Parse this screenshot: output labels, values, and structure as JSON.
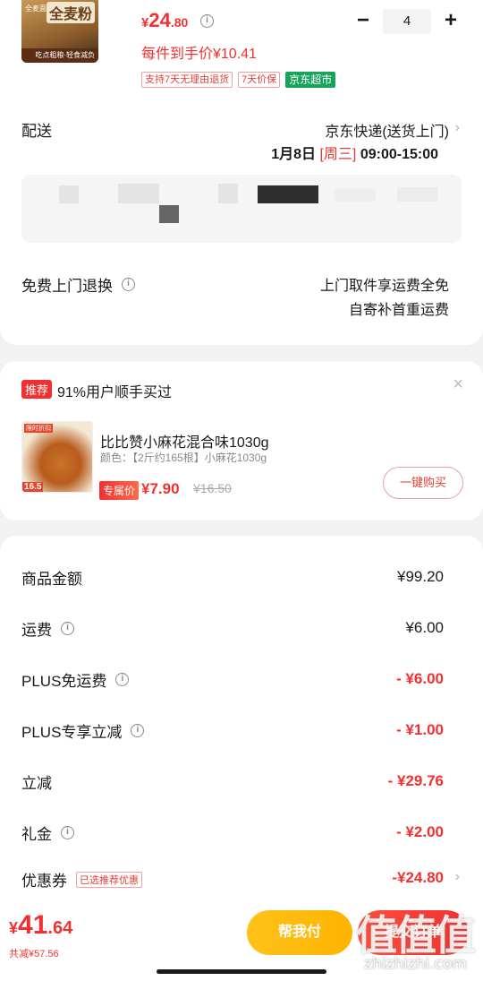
{
  "product": {
    "thumb_title": "全麦粉",
    "thumb_corner": "全麦面",
    "thumb_bottom": "吃点粗粮·轻食减负",
    "price_yen": "¥",
    "price_int": "24",
    "price_dec": ".80",
    "per_unit": "每件到手价¥10.41",
    "tags": [
      "支持7天无理由退货",
      "7天价保",
      "京东超市"
    ],
    "qty": "4",
    "minus": "−",
    "plus": "+"
  },
  "delivery": {
    "label": "配送",
    "method": "京东快递(送货上门)",
    "date": "1月8日",
    "weekday": "[周三]",
    "time": "09:00-15:00"
  },
  "return_service": {
    "label": "免费上门退换",
    "line1": "上门取件享运费全免",
    "line2": "自寄补首重运费"
  },
  "recommend": {
    "badge": "推荐",
    "title": "91%用户顺手买过",
    "close": "×",
    "img_top": "限时折扣",
    "img_bottom": "16.5",
    "name": "比比赞小麻花混合味1030g",
    "spec": "颜色：【2斤约165根】小麻花1030g",
    "exclusive": "专属价",
    "price": "¥7.90",
    "original": "¥16.50",
    "buy": "一键购买"
  },
  "summary": [
    {
      "label": "商品金额",
      "value": "¥99.20",
      "info": false,
      "red": false
    },
    {
      "label": "运费",
      "value": "¥6.00",
      "info": true,
      "red": false
    },
    {
      "label": "PLUS免运费",
      "value": "- ¥6.00",
      "info": true,
      "red": true
    },
    {
      "label": "PLUS专享立减",
      "value": "- ¥1.00",
      "info": true,
      "red": true
    },
    {
      "label": "立减",
      "value": "- ¥29.76",
      "info": false,
      "red": true
    },
    {
      "label": "礼金",
      "value": "- ¥2.00",
      "info": true,
      "red": true
    }
  ],
  "coupon": {
    "label": "优惠券",
    "tag": "已选推荐优惠",
    "value": "-¥24.80"
  },
  "bottom": {
    "yen": "¥",
    "total_int": "41",
    "total_dec": ".64",
    "saved": "共减¥57.56",
    "help": "帮我付",
    "submit": "提交订单"
  },
  "watermark": {
    "logo": "值值值",
    "site": "zhizhizhi.com"
  },
  "colors": {
    "accent_red": "#f23030",
    "green_tag": "#17a45a",
    "help_yellow": "#ffb300"
  }
}
